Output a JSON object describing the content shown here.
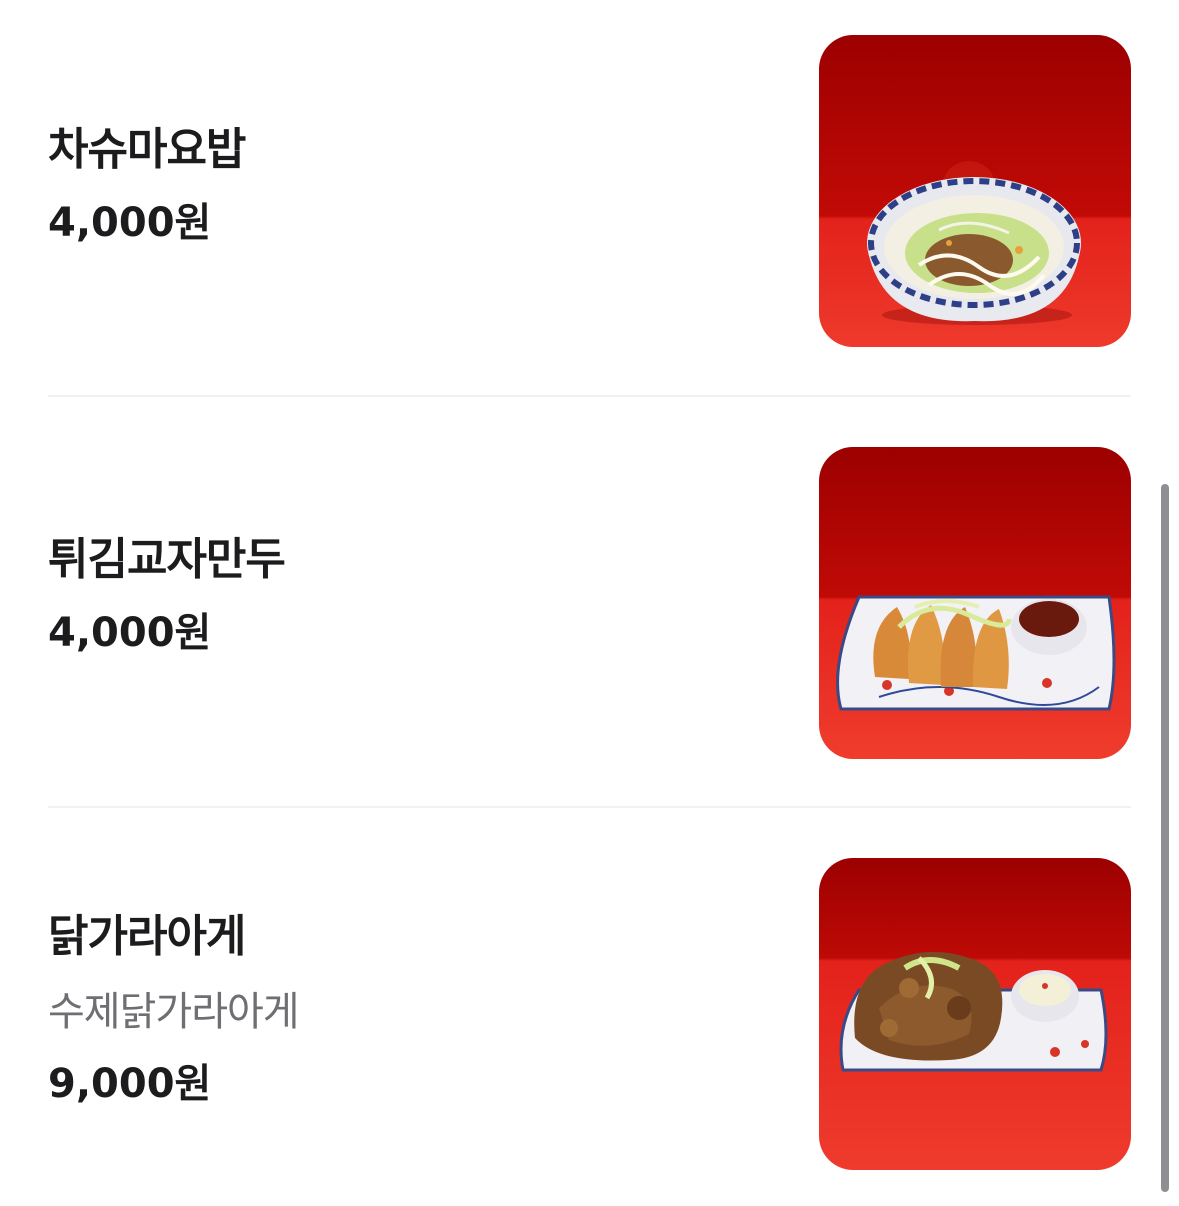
{
  "menu": {
    "items": [
      {
        "name": "차슈마요밥",
        "price": "4,000원",
        "image_icon": "chashu-mayo-rice-bowl"
      },
      {
        "name": "튀김교자만두",
        "price": "4,000원",
        "image_icon": "fried-gyoza-plate"
      },
      {
        "name": "닭가라아게",
        "description": "수제닭가라아게",
        "price": "9,000원",
        "image_icon": "chicken-karaage-plate"
      }
    ]
  },
  "colors": {
    "background": "#ffffff",
    "text_primary": "#1c1c1e",
    "text_secondary": "#6e6e73",
    "divider": "#f1f1f3",
    "photo_backdrop": "#b00000",
    "photo_table": "#e8261e"
  }
}
